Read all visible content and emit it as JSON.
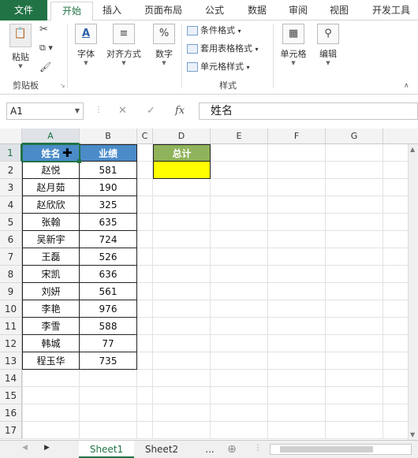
{
  "ribbon_tabs": [
    "文件",
    "开始",
    "插入",
    "页面布局",
    "公式",
    "数据",
    "审阅",
    "视图",
    "开发工具"
  ],
  "clipboard": {
    "paste": "粘贴",
    "group": "剪贴板"
  },
  "font": {
    "label": "字体"
  },
  "align": {
    "label": "对齐方式"
  },
  "number": {
    "label": "数字"
  },
  "styles": {
    "cond_format": "条件格式",
    "table_format": "套用表格格式",
    "cell_styles": "单元格样式",
    "group": "样式"
  },
  "cells_btn": {
    "label": "单元格"
  },
  "edit_btn": {
    "label": "编辑"
  },
  "formula_bar": {
    "name_box": "A1",
    "cancel": "✕",
    "enter": "✓",
    "fx": "fx",
    "value": "姓名"
  },
  "columns": [
    "A",
    "B",
    "C",
    "D",
    "E",
    "F",
    "G"
  ],
  "rows": [
    "1",
    "2",
    "3",
    "4",
    "5",
    "6",
    "7",
    "8",
    "9",
    "10",
    "11",
    "12",
    "13",
    "14",
    "15",
    "16",
    "17"
  ],
  "table": {
    "headers": [
      "姓名",
      "业绩"
    ],
    "rows": [
      [
        "赵悦",
        "581"
      ],
      [
        "赵月茹",
        "190"
      ],
      [
        "赵欣欣",
        "325"
      ],
      [
        "张翰",
        "635"
      ],
      [
        "吴新宇",
        "724"
      ],
      [
        "王磊",
        "526"
      ],
      [
        "宋凯",
        "636"
      ],
      [
        "刘妍",
        "561"
      ],
      [
        "李艳",
        "976"
      ],
      [
        "李雪",
        "588"
      ],
      [
        "韩城",
        "77"
      ],
      [
        "程玉华",
        "735"
      ]
    ]
  },
  "summary": {
    "header": "总计",
    "value": ""
  },
  "sheets": {
    "tab1": "Sheet1",
    "tab2": "Sheet2",
    "more": "...",
    "add": "⊕"
  },
  "colors": {
    "file_tab": "#217346",
    "header_fill": "#4a8bc8",
    "total_header": "#8fb35a",
    "total_fill": "#ffff00"
  }
}
